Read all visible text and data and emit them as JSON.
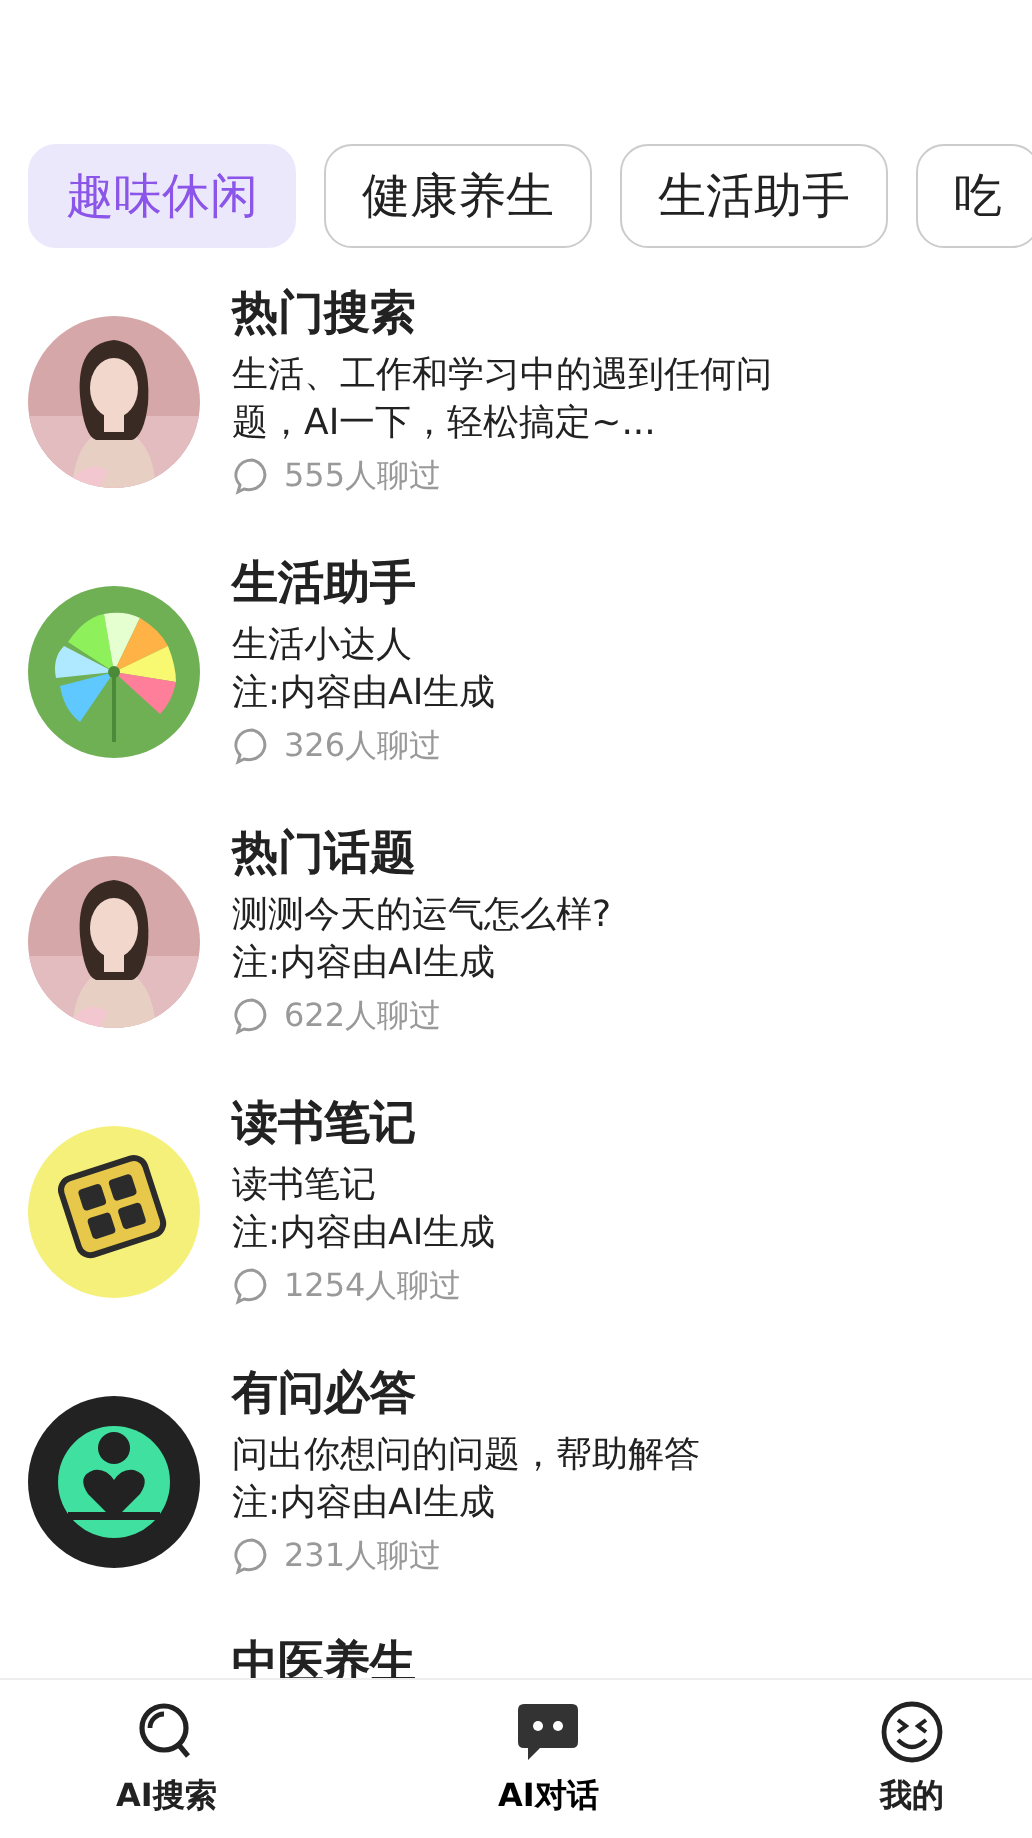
{
  "tabs": [
    {
      "label": "趣味休闲",
      "selected": true
    },
    {
      "label": "健康养生",
      "selected": false
    },
    {
      "label": "生活助手",
      "selected": false
    },
    {
      "label": "吃",
      "selected": false
    }
  ],
  "bots": [
    {
      "kind": "picture",
      "title": "热门搜索",
      "description": "生活、工作和学习中的遇到任何问题，AI一下，轻松搞定~...",
      "chats": "555人聊过"
    },
    {
      "kind": "fan",
      "title": "生活助手",
      "description": "生活小达人",
      "note": "注:内容由AI生成",
      "chats": "326人聊过"
    },
    {
      "kind": "picture",
      "title": "热门话题",
      "description": "测测今天的运气怎么样?",
      "note": "注:内容由AI生成",
      "chats": "622人聊过"
    },
    {
      "kind": "book",
      "title": "读书笔记",
      "description": "读书笔记",
      "note": "注:内容由AI生成",
      "chats": "1254人聊过"
    },
    {
      "kind": "heart",
      "title": "有问必答",
      "description": "问出你想问的问题，帮助解答",
      "note": "注:内容由AI生成",
      "chats": "231人聊过"
    },
    {
      "kind": "partial",
      "title": "中医养生"
    }
  ],
  "nav": [
    {
      "kind": "search",
      "label": "AI搜索",
      "selected": false
    },
    {
      "kind": "chat",
      "label": "AI对话",
      "selected": true
    },
    {
      "kind": "face",
      "label": "我的",
      "selected": false
    }
  ]
}
